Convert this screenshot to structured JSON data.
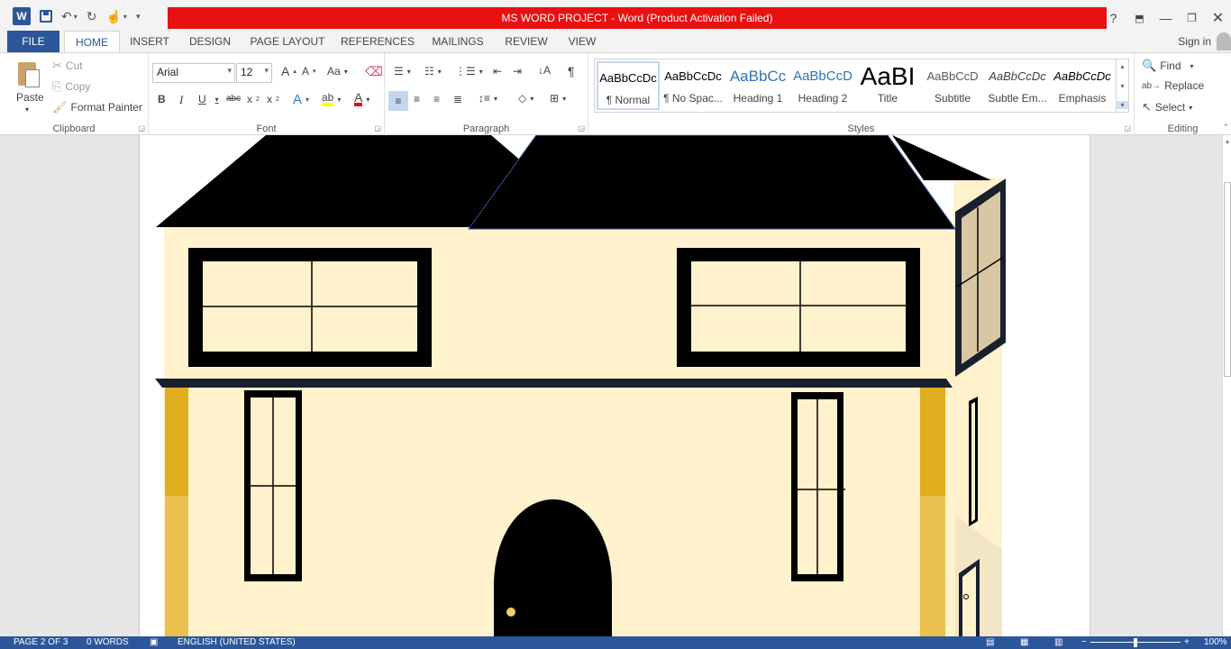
{
  "window": {
    "title": "MS WORD PROJECT -  Word (Product Activation Failed)",
    "signin": "Sign in",
    "help": "?"
  },
  "tabs": [
    "FILE",
    "HOME",
    "INSERT",
    "DESIGN",
    "PAGE LAYOUT",
    "REFERENCES",
    "MAILINGS",
    "REVIEW",
    "VIEW"
  ],
  "clipboard": {
    "label": "Clipboard",
    "paste": "Paste",
    "cut": "Cut",
    "copy": "Copy",
    "format_painter": "Format Painter"
  },
  "font": {
    "label": "Font",
    "family": "Arial",
    "size": "12",
    "case_label": "Aa"
  },
  "paragraph": {
    "label": "Paragraph"
  },
  "styles": {
    "label": "Styles",
    "items": [
      {
        "preview": "AaBbCcDc",
        "name": "¶ Normal"
      },
      {
        "preview": "AaBbCcDc",
        "name": "¶ No Spac..."
      },
      {
        "preview": "AaBbCc",
        "name": "Heading 1"
      },
      {
        "preview": "AaBbCcD",
        "name": "Heading 2"
      },
      {
        "preview": "AaBI",
        "name": "Title"
      },
      {
        "preview": "AaBbCcD",
        "name": "Subtitle"
      },
      {
        "preview": "AaBbCcDc",
        "name": "Subtle Em..."
      },
      {
        "preview": "AaBbCcDc",
        "name": "Emphasis"
      }
    ]
  },
  "editing": {
    "label": "Editing",
    "find": "Find",
    "replace": "Replace",
    "select": "Select"
  },
  "statusbar": {
    "page": "PAGE 2 OF 3",
    "words": "0 WORDS",
    "language": "ENGLISH (UNITED STATES)",
    "zoom": "100%"
  },
  "colors": {
    "word_blue": "#2b579a",
    "activation_red": "#e81010",
    "house_wall": "#fff2cc",
    "roof": "#000000",
    "pillar_gold": "#e0ad1e",
    "side_window_glass": "#d9c7a4"
  }
}
